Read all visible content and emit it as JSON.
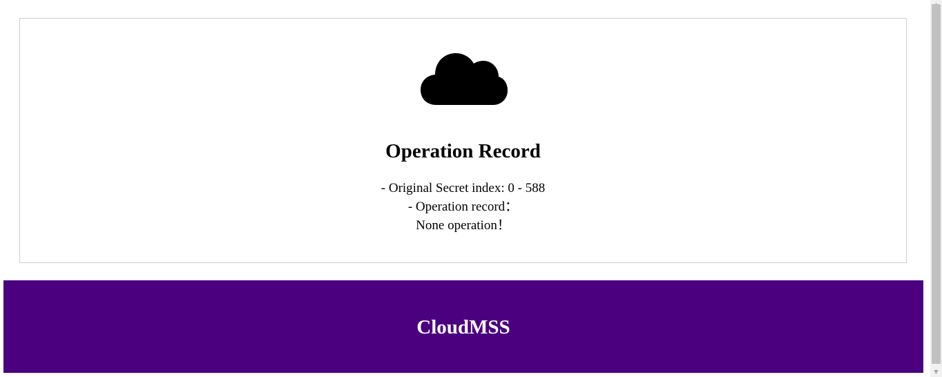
{
  "card": {
    "icon": "cloud-icon",
    "title": "Operation Record",
    "lines": [
      "- Original Secret index: 0 - 588",
      "- Operation record：",
      "None operation！"
    ]
  },
  "footer": {
    "title": "CloudMSS",
    "background": "#4b0080"
  },
  "scrollbar": {
    "up_icon": "▲",
    "down_icon": "▼"
  }
}
